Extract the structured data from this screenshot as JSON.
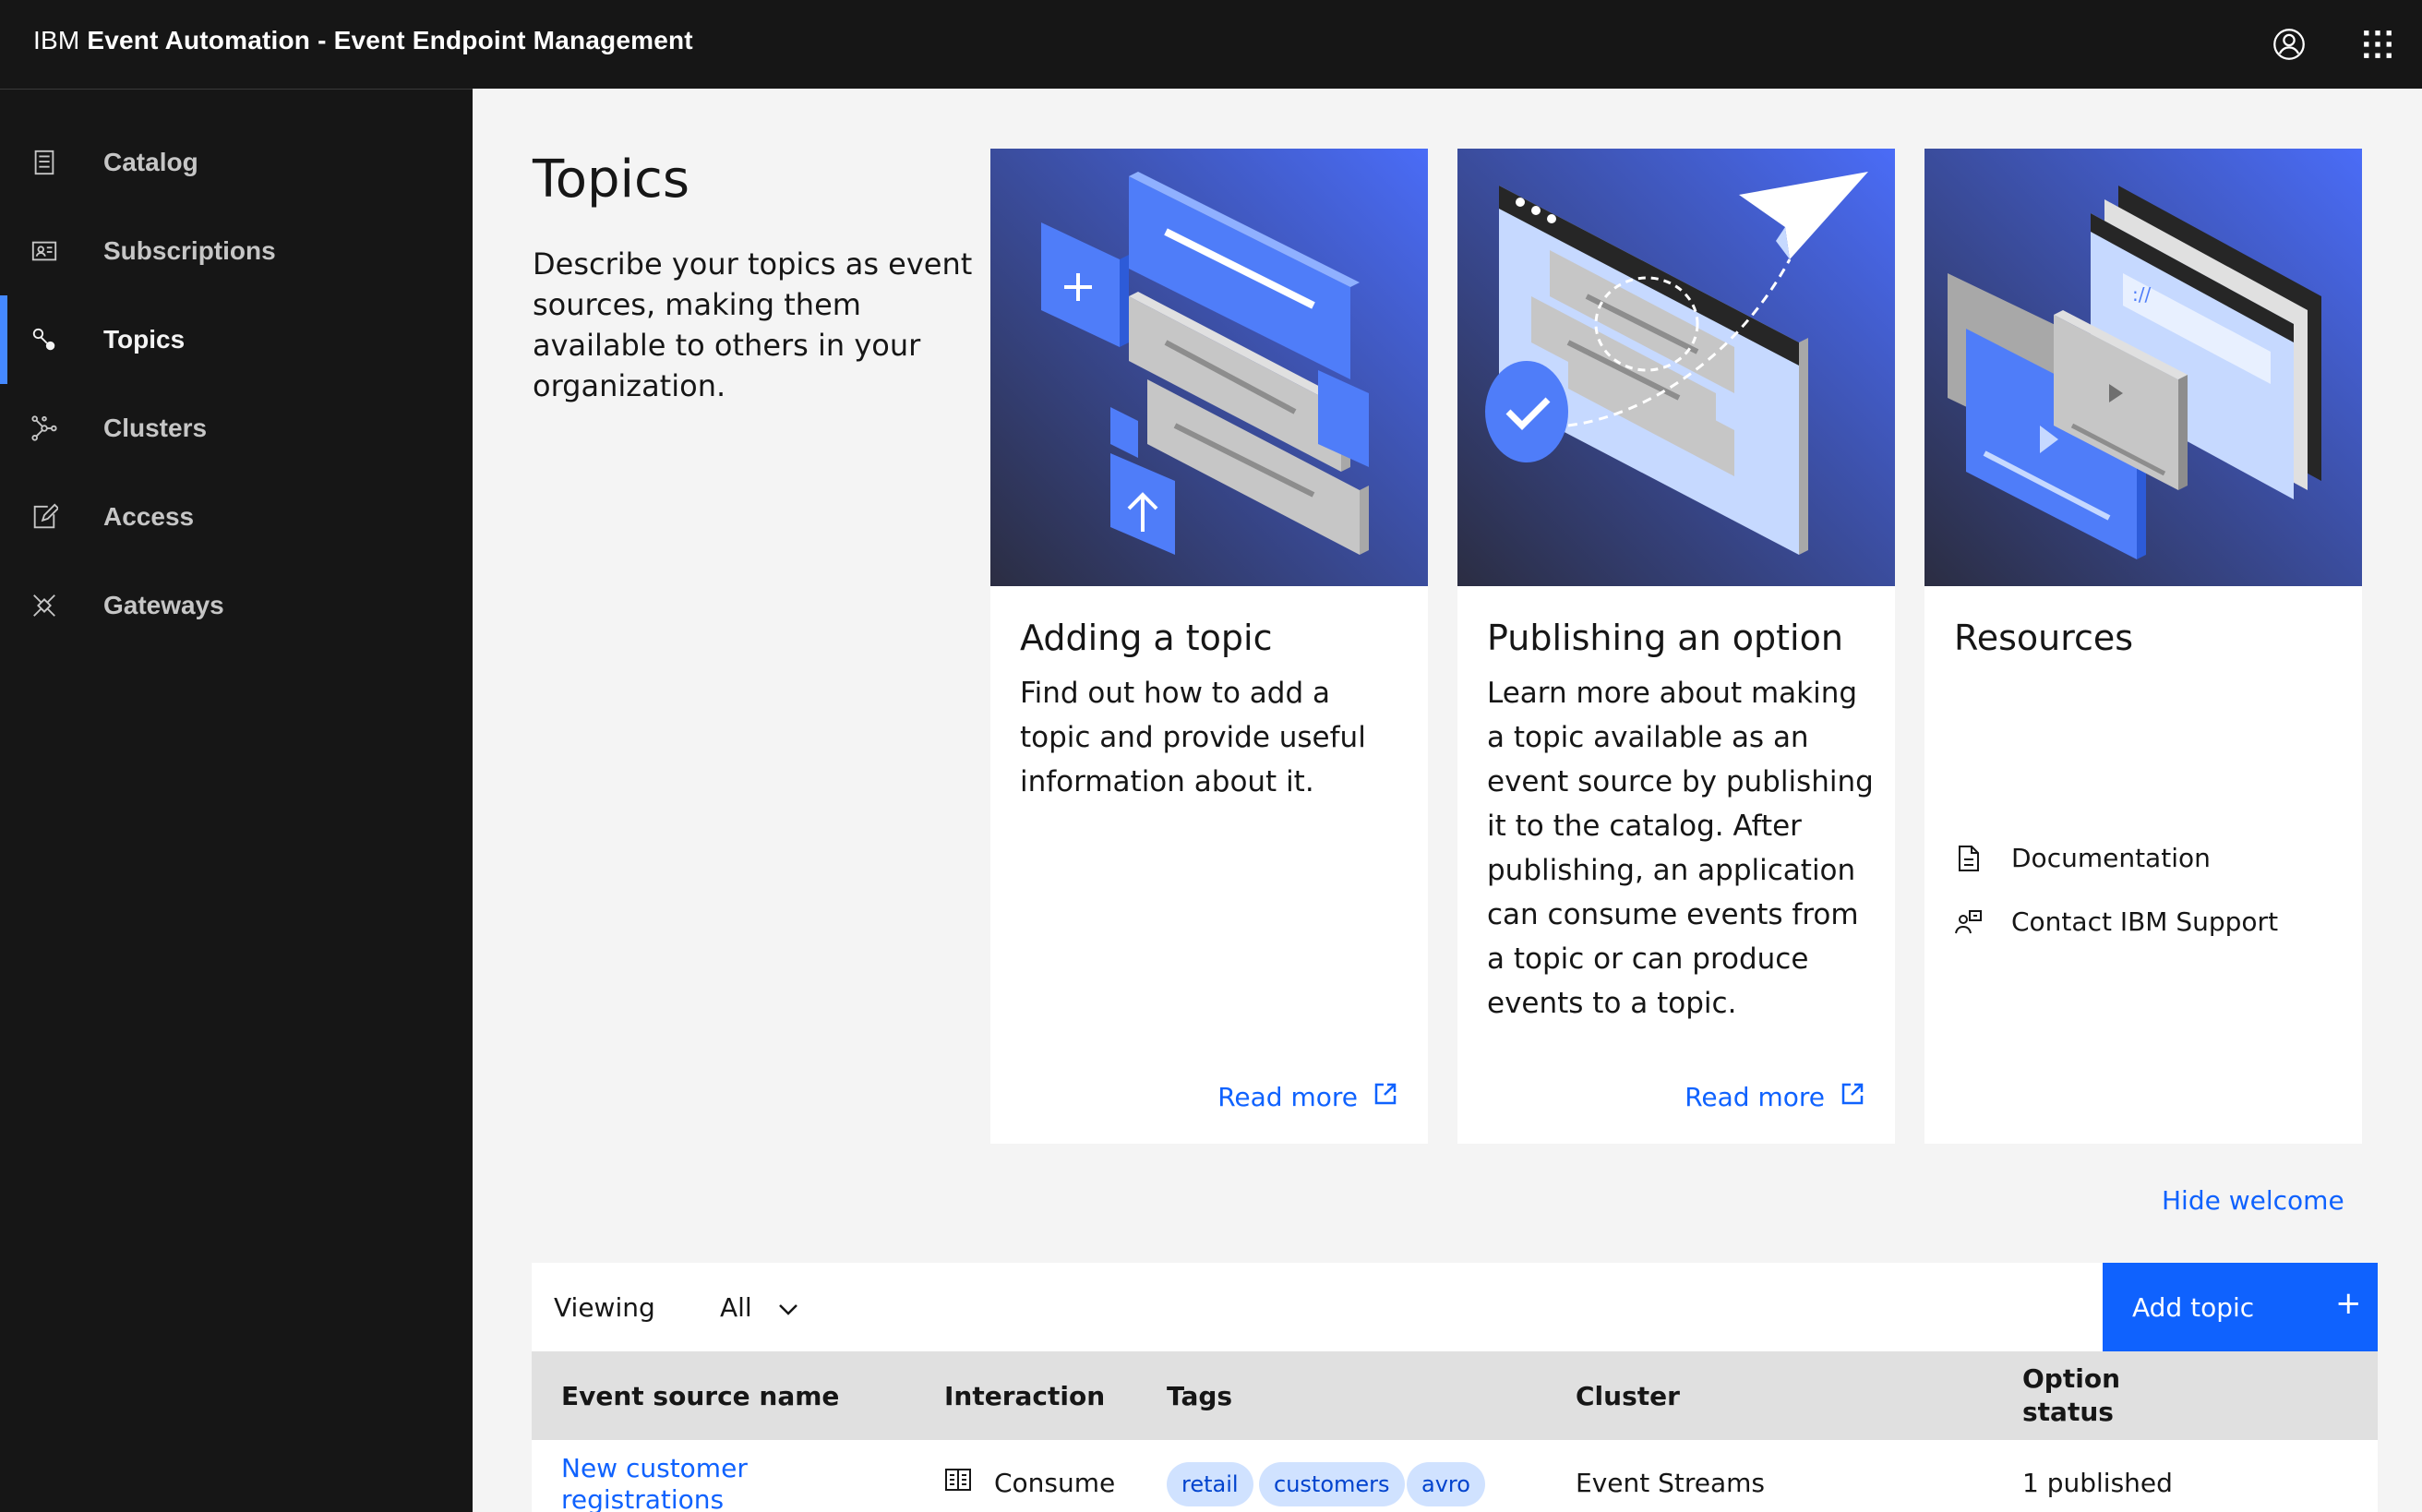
{
  "header": {
    "brand_prefix": "IBM",
    "product_name": "Event Automation - Event Endpoint Management",
    "user_icon": "user-avatar-icon",
    "switcher_icon": "app-switcher-icon"
  },
  "sidebar": {
    "items": [
      {
        "label": "Catalog",
        "icon": "catalog-icon",
        "active": false
      },
      {
        "label": "Subscriptions",
        "icon": "subscriptions-icon",
        "active": false
      },
      {
        "label": "Topics",
        "icon": "topics-icon",
        "active": true
      },
      {
        "label": "Clusters",
        "icon": "clusters-icon",
        "active": false
      },
      {
        "label": "Access",
        "icon": "access-icon",
        "active": false
      },
      {
        "label": "Gateways",
        "icon": "gateways-icon",
        "active": false
      }
    ],
    "collapse_icon": "close-icon"
  },
  "page": {
    "title": "Topics",
    "description": "Describe your topics as event sources, making them available to others in your organization."
  },
  "cards": [
    {
      "title": "Adding a topic",
      "body": "Find out how to add a topic and provide useful information about it.",
      "link": "Read more"
    },
    {
      "title": "Publishing an option",
      "body": "Learn more about making a topic available as an event source by publishing it to the catalog. After publishing, an application can consume events from a topic or can produce events to a topic.",
      "link": "Read more"
    },
    {
      "title": "Resources",
      "links": [
        "Documentation",
        "Contact IBM Support"
      ]
    }
  ],
  "welcome": {
    "hide_label": "Hide welcome"
  },
  "toolbar": {
    "viewing_label": "Viewing",
    "viewing_value": "All",
    "add_button": "Add topic",
    "add_icon": "+"
  },
  "table": {
    "columns": [
      "Event source name",
      "Interaction",
      "Tags",
      "Cluster",
      "Option status"
    ],
    "rows": [
      {
        "name": "New customer registrations",
        "interaction": "Consume",
        "tags": [
          "retail",
          "customers",
          "avro"
        ],
        "cluster": "Event Streams",
        "status": "1 published"
      }
    ]
  },
  "colors": {
    "header_bg": "#161616",
    "accent": "#0f62fe",
    "nav_active_bar": "#4589ff",
    "tag_bg": "#d0e2ff"
  }
}
